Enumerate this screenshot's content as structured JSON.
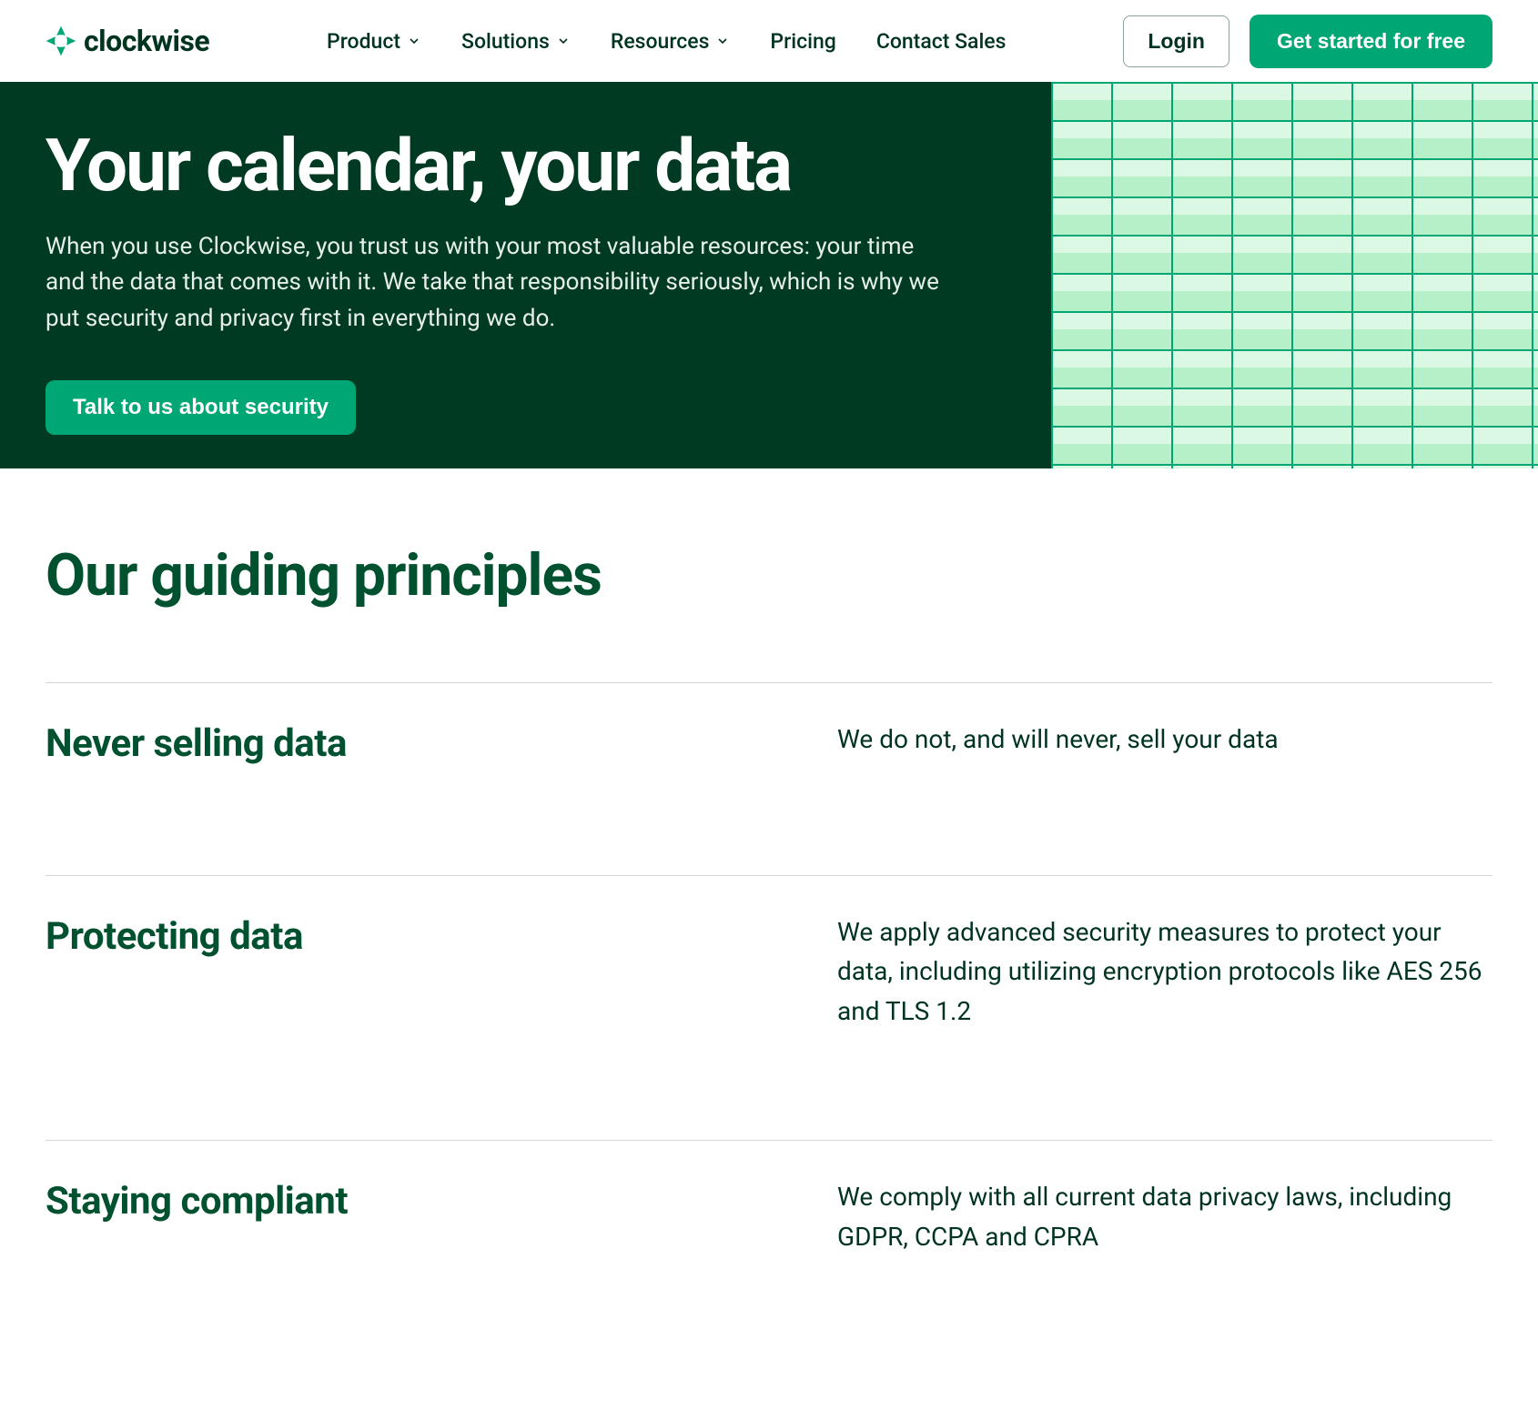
{
  "nav": {
    "brand": "clockwise",
    "items": [
      {
        "label": "Product",
        "dropdown": true
      },
      {
        "label": "Solutions",
        "dropdown": true
      },
      {
        "label": "Resources",
        "dropdown": true
      },
      {
        "label": "Pricing",
        "dropdown": false
      },
      {
        "label": "Contact Sales",
        "dropdown": false
      }
    ],
    "login": "Login",
    "cta": "Get started for free"
  },
  "hero": {
    "title": "Your calendar, your data",
    "subtitle": "When you use Clockwise, you trust us with your most valuable resources: your time and the data that comes with it. We take that responsibility seriously, which is why we put security and privacy first in everything we do.",
    "button": "Talk to us about security"
  },
  "principles": {
    "heading": "Our guiding principles",
    "rows": [
      {
        "title": "Never selling data",
        "body": "We do not, and will never, sell your data"
      },
      {
        "title": "Protecting data",
        "body": "We apply advanced security measures to protect your data, including utilizing encryption protocols like AES 256 and TLS 1.2"
      },
      {
        "title": "Staying compliant",
        "body": "We comply with all current data privacy laws, including GDPR, CCPA and CPRA"
      }
    ]
  },
  "colors": {
    "accent": "#00a674",
    "dark": "#003a23",
    "heading": "#00512f"
  }
}
